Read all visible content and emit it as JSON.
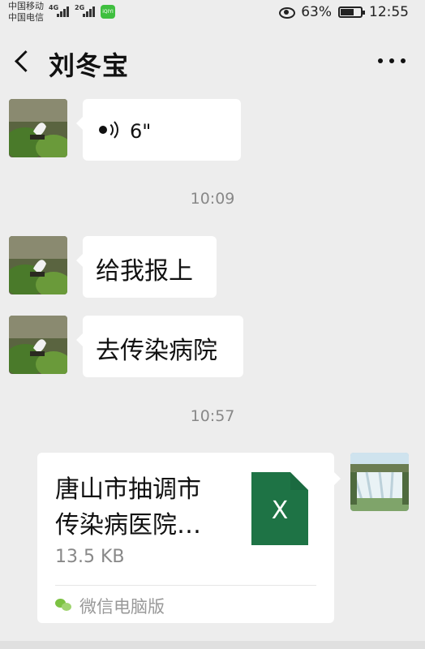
{
  "status_bar": {
    "carrier_1": "中国移动",
    "carrier_2": "中国电信",
    "net_1": "4G",
    "net_2": "2G",
    "app_badge": "iQIYI",
    "battery": "63%",
    "time": "12:55"
  },
  "header": {
    "title": "刘冬宝",
    "back_icon": "chevron-left-icon",
    "more_icon": "more-dots-icon"
  },
  "messages": {
    "voice": {
      "duration": "6\""
    },
    "time_1": "10:09",
    "text_1": "给我报上",
    "text_2": "去传染病院",
    "time_2": "10:57",
    "file": {
      "name_line_1": "唐山市抽调市",
      "name_line_2": "传染病医院…",
      "size": "13.5 KB",
      "icon_letter": "X",
      "source": "微信电脑版"
    }
  },
  "colors": {
    "background": "#ededed",
    "bubble": "#ffffff",
    "excel_green": "#1e7345",
    "timestamp": "#888888"
  }
}
